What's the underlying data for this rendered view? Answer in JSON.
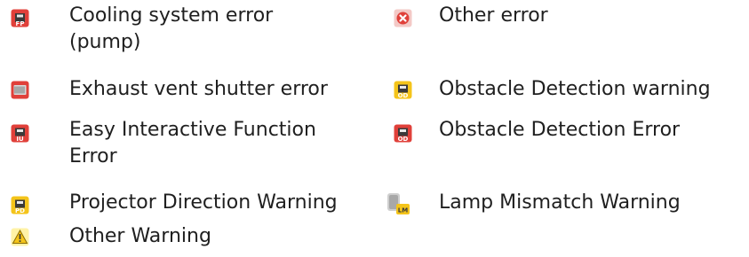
{
  "colors": {
    "error_red": "#e0403a",
    "warning_yellow": "#f4c41a",
    "icon_dark": "#3a3a3a",
    "text": "#1f1f1f"
  },
  "items": [
    {
      "icon": "fp-icon",
      "badge": "FP",
      "line1": "Cooling system error",
      "line2": "(pump)"
    },
    {
      "icon": "x-icon",
      "line1": "Other error"
    },
    {
      "icon": "shutter-icon",
      "line1": "Exhaust vent shutter error"
    },
    {
      "icon": "od-warning-icon",
      "badge": "OD",
      "line1": "Obstacle Detection warning"
    },
    {
      "icon": "iu-icon",
      "badge": "IU",
      "line1": "Easy Interactive Function",
      "line2": "Error"
    },
    {
      "icon": "od-error-icon",
      "badge": "OD",
      "line1": "Obstacle Detection Error"
    },
    {
      "icon": "pd-icon",
      "badge": "PD",
      "line1": "Projector Direction Warning"
    },
    {
      "icon": "lm-icon",
      "badge": "LM",
      "line1": "Lamp Mismatch Warning"
    },
    {
      "icon": "warning-triangle-icon",
      "line1": "Other Warning"
    }
  ]
}
